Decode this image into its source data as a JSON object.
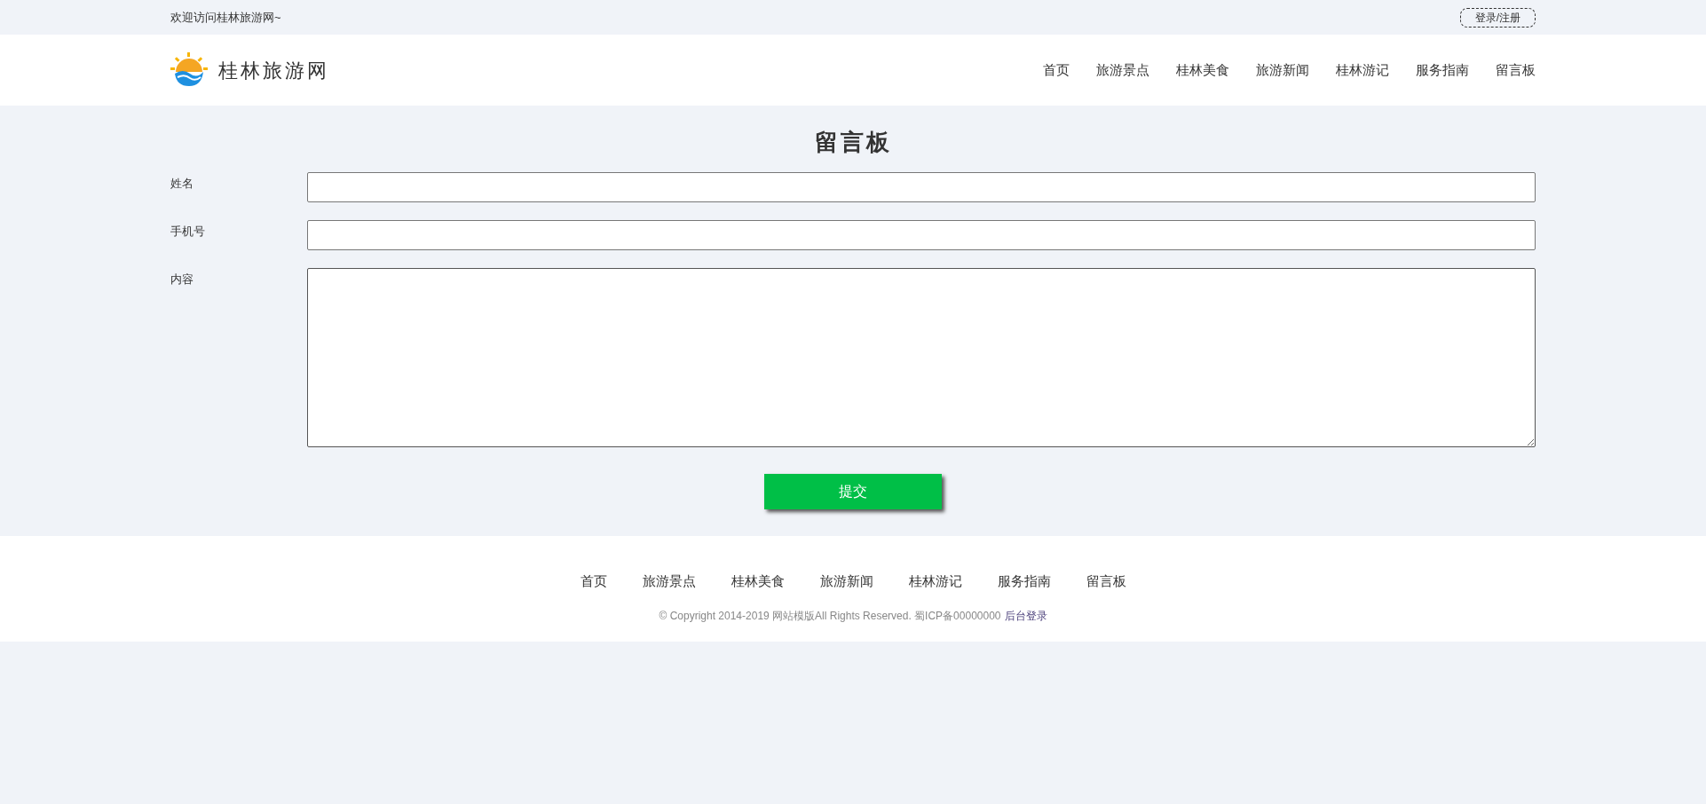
{
  "top_bar": {
    "welcome": "欢迎访问桂林旅游网~",
    "login": "登录/注册"
  },
  "header": {
    "site_name": "桂林旅游网",
    "nav": [
      {
        "label": "首页",
        "selected": false
      },
      {
        "label": "旅游景点",
        "selected": false
      },
      {
        "label": "桂林美食",
        "selected": false
      },
      {
        "label": "旅游新闻",
        "selected": false
      },
      {
        "label": "桂林游记",
        "selected": false
      },
      {
        "label": "服务指南",
        "selected": false
      },
      {
        "label": "留言板",
        "selected": false
      }
    ]
  },
  "form": {
    "title": "留言板",
    "fields": [
      {
        "label": "姓名",
        "kind": "input"
      },
      {
        "label": "手机号",
        "kind": "input"
      },
      {
        "label": "内容",
        "kind": "textarea"
      }
    ],
    "submit": "提交"
  },
  "footer": {
    "nav": [
      "首页",
      "旅游景点",
      "桂林美食",
      "旅游新闻",
      "桂林游记",
      "服务指南",
      "留言板"
    ],
    "copyright": "© Copyright 2014-2019 网站模版All Rights Reserved. 蜀ICP备00000000",
    "admin_link": "后台登录"
  }
}
